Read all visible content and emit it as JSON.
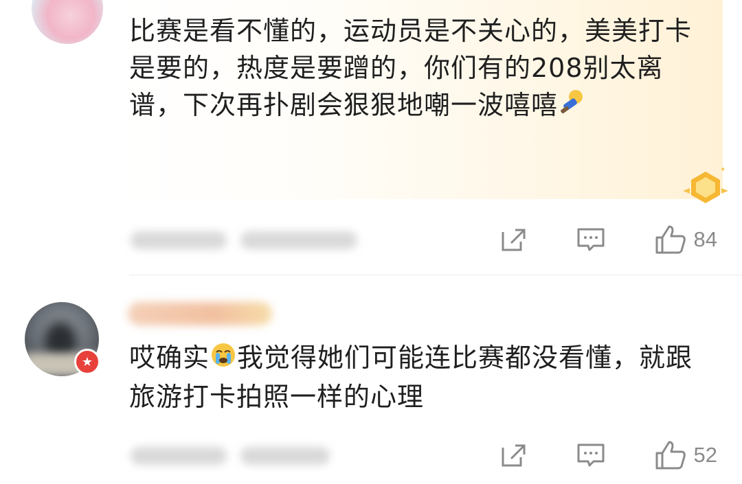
{
  "comments": [
    {
      "text": "比赛是看不懂的，运动员是不关心的，美美打卡是要的，热度是要蹭的，你们有的208别太离谱，下次再扑剧会狠狠地嘲一波嘻嘻",
      "emoji": "smug-face-emoji",
      "likes": "84"
    },
    {
      "text_before_emoji": "哎确实",
      "emoji": "crying-face-emoji",
      "text_after_emoji": "我觉得她们可能连比赛都没看懂，就跟旅游打卡拍照一样的心理",
      "likes": "52"
    }
  ],
  "icons": {
    "share": "share-icon",
    "reply": "comment-icon",
    "like": "thumbs-up-icon"
  },
  "colors": {
    "accent_red": "#e8413c",
    "action_gray": "#8a8a8a",
    "highlight_bg": "#fff1d6"
  }
}
